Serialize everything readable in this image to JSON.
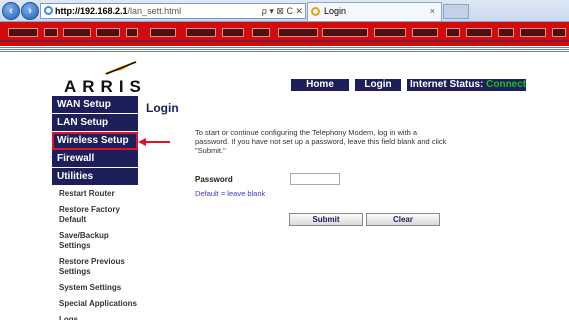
{
  "browser": {
    "url_host": "http://192.168.2.1",
    "url_path": "/lan_sett.html",
    "address_tools": "ρ ▾ ⊠ C ✕",
    "tab_title": "Login",
    "tab_close": "×"
  },
  "logo": {
    "text": "ARRIS"
  },
  "topnav": {
    "home": "Home",
    "login": "Login",
    "status_label": "Internet Status:",
    "status_value": "Connected"
  },
  "sidebar": {
    "main_items": [
      {
        "label": "WAN Setup"
      },
      {
        "label": "LAN Setup"
      },
      {
        "label": "Wireless Setup"
      },
      {
        "label": "Firewall"
      },
      {
        "label": "Utilities"
      }
    ],
    "sub_items": [
      {
        "label": "Restart Router"
      },
      {
        "label": "Restore Factory Default"
      },
      {
        "label": "Save/Backup Settings"
      },
      {
        "label": "Restore Previous Settings"
      },
      {
        "label": "System Settings"
      },
      {
        "label": "Special Applications"
      },
      {
        "label": "Logs"
      }
    ]
  },
  "content": {
    "title": "Login",
    "description": "To start or continue configuring the Telephony Modem, log in with a password. If you have not set up a password, leave this field blank and click \"Submit.\"",
    "password_label": "Password",
    "password_value": "",
    "password_hint": "Default = leave blank",
    "submit_label": "Submit",
    "clear_label": "Clear"
  },
  "colors": {
    "nav_bg": "#1d1f5a",
    "banner_red": "#d30b0b",
    "connected_green": "#19c219",
    "highlight_red": "#e0102a"
  }
}
